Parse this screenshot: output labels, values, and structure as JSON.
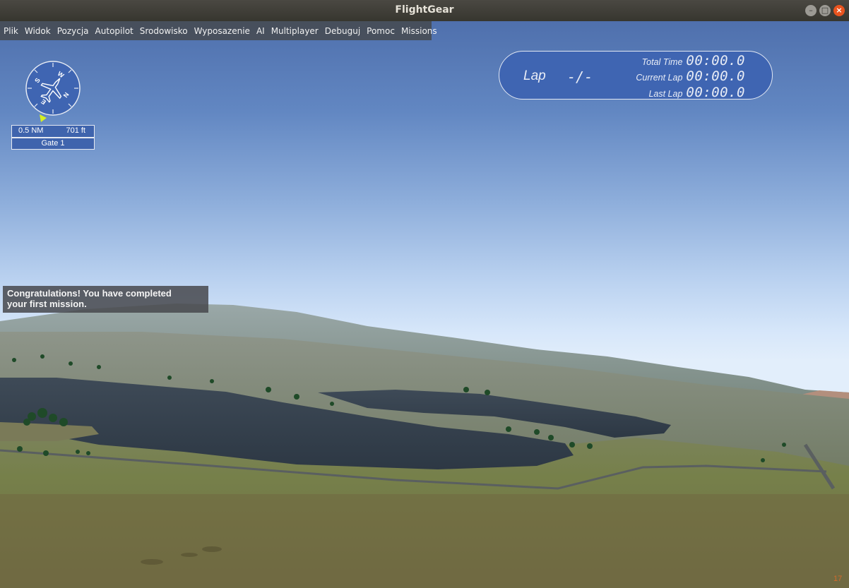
{
  "window": {
    "title": "FlightGear",
    "controls": [
      "minimize-icon",
      "maximize-icon",
      "close-icon"
    ]
  },
  "menu": {
    "items": [
      "Plik",
      "Widok",
      "Pozycja",
      "Autopilot",
      "Srodowisko",
      "Wyposazenie",
      "AI",
      "Multiplayer",
      "Debuguj",
      "Pomoc",
      "Missions"
    ]
  },
  "compass": {
    "labels": [
      "W",
      "N",
      "E",
      "S"
    ],
    "icon": "aircraft-icon",
    "distance": "0.5 NM",
    "altitude": "701 ft",
    "gate": "Gate 1"
  },
  "lap": {
    "label": "Lap",
    "count": "-/-",
    "total_time_label": "Total Time",
    "total_time": "00:00.0",
    "current_lap_label": "Current Lap",
    "current_lap": "00:00.0",
    "last_lap_label": "Last Lap",
    "last_lap": "00:00.0"
  },
  "message": {
    "line1": "Congratulations! You have completed",
    "line2": "your first mission."
  },
  "fps": "17",
  "colors": {
    "hud_blue": "#3f65b2",
    "menu_bg": "#46484a",
    "close_button": "#e9541f",
    "fps_text": "#d26a2c"
  }
}
